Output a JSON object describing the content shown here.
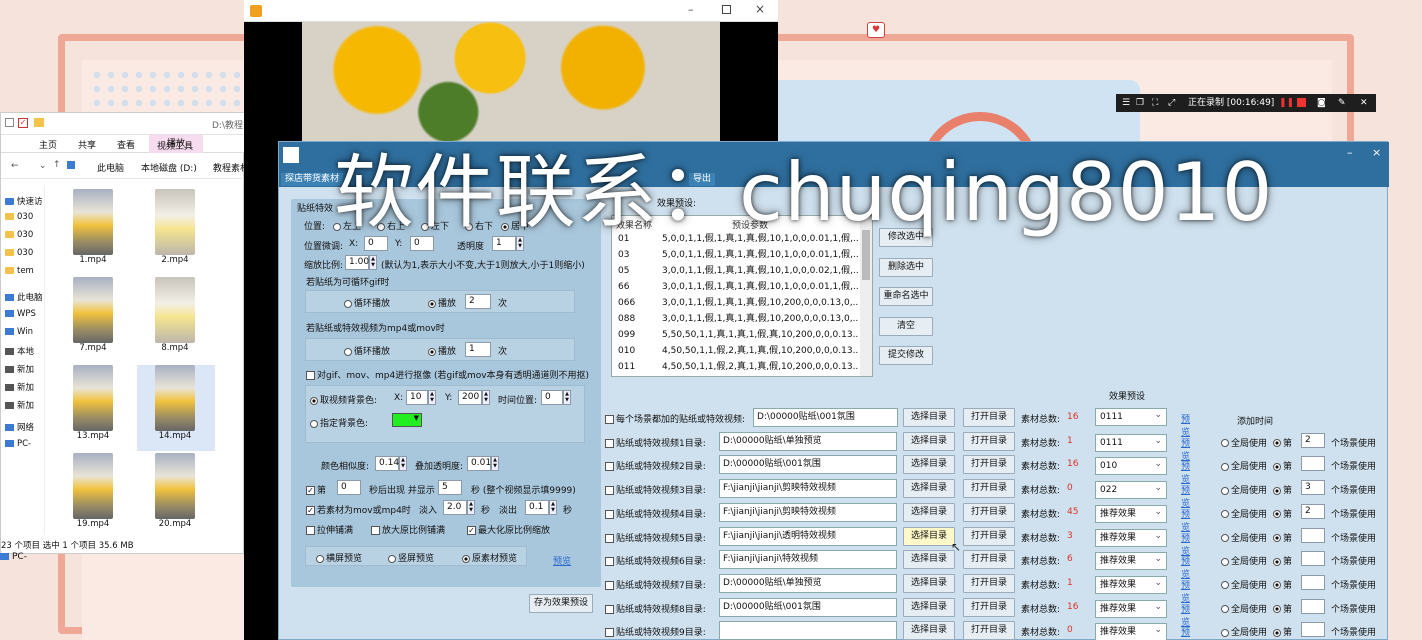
{
  "explorer": {
    "ribbon_tabs": [
      "主页",
      "共享",
      "查看",
      "视频工具"
    ],
    "play_tab": "播放",
    "title_path": "D:\\教程",
    "breadcrumb": [
      "此电脑",
      "本地磁盘 (D:)",
      "教程素材"
    ],
    "sidebar": [
      {
        "icon": "folder-icon",
        "label": "快速访"
      },
      {
        "icon": "folder-icon",
        "label": "030"
      },
      {
        "icon": "folder-icon",
        "label": "030"
      },
      {
        "icon": "folder-icon",
        "label": "030"
      },
      {
        "icon": "folder-icon",
        "label": "tem"
      },
      {
        "icon": "pc-icon",
        "label": "此电脑"
      },
      {
        "icon": "pc-icon",
        "label": "WPS"
      },
      {
        "icon": "pc-icon",
        "label": "Win"
      },
      {
        "icon": "pc-icon",
        "label": "本地"
      },
      {
        "icon": "pc-icon",
        "label": "新加"
      },
      {
        "icon": "pc-icon",
        "label": "新加"
      },
      {
        "icon": "pc-icon",
        "label": "新加"
      },
      {
        "icon": "pc-icon",
        "label": "网络"
      },
      {
        "icon": "pc-icon",
        "label": "PC-"
      }
    ],
    "files": [
      "1.mp4",
      "2.mp4",
      "7.mp4",
      "8.mp4",
      "13.mp4",
      "14.mp4",
      "19.mp4",
      "20.mp4"
    ],
    "status": "23 个项目    选中 1 个项目  35.6 MB",
    "taskbar_item": "PC-"
  },
  "app": {
    "tabs": [
      "探店带货素材",
      "导出"
    ],
    "group_title": "贴纸特效",
    "position_label": "位置:",
    "position_options": [
      "左上",
      "右上",
      "左下",
      "右下",
      "居中"
    ],
    "offset_label": "位置微调:",
    "x_label": "X:",
    "x_value": "0",
    "y_label": "Y:",
    "y_value": "0",
    "opacity_label": "透明度",
    "opacity_value": "1",
    "scale_label": "缩放比例:",
    "scale_value": "1.00",
    "scale_hint": "(默认为1,表示大小不变,大于1则放大,小于1则缩小)",
    "gif_title": "若贴纸为可循环gif时",
    "gif_loop": "循环播放",
    "gif_play": "播放",
    "gif_times": "2",
    "gif_unit": "次",
    "mov_title": "若贴纸或特效视频为mp4或mov时",
    "mov_loop": "循环播放",
    "mov_play": "播放",
    "mov_times": "1",
    "mov_unit": "次",
    "keying_label": "对gif、mov、mp4进行抠像 (若gif或mov本身有透明通道则不用抠)",
    "take_bg_label": "取视频背景色:",
    "bg_x": "10",
    "bg_y": "200",
    "time_pos_label": "时间位置:",
    "time_pos": "0",
    "assign_bg_label": "指定背景色:",
    "bg_color": "#22ee22",
    "similarity_label": "颜色相似度:",
    "similarity": "0.14",
    "overlay_opacity_label": "叠加透明度:",
    "overlay_opacity": "0.01",
    "appear_prefix": "第",
    "appear_value": "0",
    "appear_mid": "秒后出现 并显示",
    "appear_secs": "5",
    "appear_suffix": "秒 (整个视频显示填9999)",
    "fade_label": "若素材为mov或mp4时",
    "fade_in_label": "淡入",
    "fade_in": "2.0",
    "fade_sec1": "秒",
    "fade_out_label": "淡出",
    "fade_out": "0.1",
    "fade_sec2": "秒",
    "stretch_label": "拉伸铺满",
    "enlarge_label": "放大原比例铺满",
    "maximize_label": "最大化原比例缩放",
    "preview_options": [
      "横屏预览",
      "竖屏预览",
      "原素材预览"
    ],
    "preview_link": "预览",
    "save_preset": "存为效果预设",
    "preset_header_label": "效果预设:",
    "preset_col1": "效果名称",
    "preset_col2": "预设参数",
    "presets": [
      {
        "id": "01",
        "val": "5,0,0,1,1,假,1,真,1,真,假,10,1,0,0,0.01,1,假,..."
      },
      {
        "id": "03",
        "val": "5,0,0,1,1,假,1,真,1,真,假,10,1,0,0,0.01,1,假,..."
      },
      {
        "id": "05",
        "val": "3,0,0,1,1,假,1,真,1,真,假,10,1,0,0,0.02,1,假,..."
      },
      {
        "id": "66",
        "val": "3,0,0,1,1,假,1,真,1,真,假,10,1,0,0,0.01,1,假,..."
      },
      {
        "id": "066",
        "val": "3,0,0,1,1,假,1,真,1,真,假,10,200,0,0,0.13,0,..."
      },
      {
        "id": "088",
        "val": "3,0,0,1,1,假,1,真,1,真,假,10,200,0,0,0.13,0,..."
      },
      {
        "id": "099",
        "val": "5,50,50,1,1,真,1,真,1,假,真,10,200,0,0,0.13..."
      },
      {
        "id": "010",
        "val": "4,50,50,1,1,假,2,真,1,真,假,10,200,0,0,0.13..."
      },
      {
        "id": "011",
        "val": "4,50,50,1,1,假,2,真,1,真,假,10,200,0,0,0.13..."
      }
    ],
    "side_buttons": [
      "修改选中",
      "删除选中",
      "重命名选中",
      "清空",
      "提交修改"
    ],
    "effects_header": "效果预设",
    "add_time_header": "添加时间",
    "rows": [
      {
        "label": "每个场景都加的贴纸或特效视频:",
        "path": "D:\\00000贴纸\\001氛围",
        "count": "16",
        "preset": "0111",
        "mode": "",
        "num": ""
      },
      {
        "label": "贴纸或特效视频1目录:",
        "path": "D:\\00000贴纸\\单独预览",
        "count": "1",
        "preset": "0111",
        "mode": "第",
        "num": "2"
      },
      {
        "label": "贴纸或特效视频2目录:",
        "path": "D:\\00000贴纸\\001氛围",
        "count": "16",
        "preset": "010",
        "mode": "第",
        "num": ""
      },
      {
        "label": "贴纸或特效视频3目录:",
        "path": "F:\\jianji\\jianji\\剪映特效视频",
        "count": "0",
        "preset": "022",
        "mode": "第",
        "num": "3"
      },
      {
        "label": "贴纸或特效视频4目录:",
        "path": "F:\\jianji\\jianji\\剪映特效视频",
        "count": "45",
        "preset": "推荐效果",
        "mode": "第",
        "num": "2"
      },
      {
        "label": "贴纸或特效视频5目录:",
        "path": "F:\\jianji\\jianji\\透明特效视频",
        "count": "3",
        "preset": "推荐效果",
        "mode": "第",
        "num": ""
      },
      {
        "label": "贴纸或特效视频6目录:",
        "path": "F:\\jianji\\jianji\\特效视频",
        "count": "6",
        "preset": "推荐效果",
        "mode": "第",
        "num": ""
      },
      {
        "label": "贴纸或特效视频7目录:",
        "path": "D:\\00000贴纸\\单独预览",
        "count": "1",
        "preset": "推荐效果",
        "mode": "第",
        "num": ""
      },
      {
        "label": "贴纸或特效视频8目录:",
        "path": "D:\\00000贴纸\\001氛围",
        "count": "16",
        "preset": "推荐效果",
        "mode": "第",
        "num": ""
      },
      {
        "label": "贴纸或特效视频9目录:",
        "path": "",
        "count": "0",
        "preset": "推荐效果",
        "mode": "第",
        "num": ""
      }
    ],
    "choose_dir": "选择目录",
    "open_dir": "打开目录",
    "count_label": "素材总数:",
    "preview": "预览",
    "global_use": "全局使用",
    "scene_use": "个场景使用"
  },
  "recorder": {
    "status": "正在录制 [00:16:49]"
  },
  "watermark": "软件联系：chuqing8010"
}
